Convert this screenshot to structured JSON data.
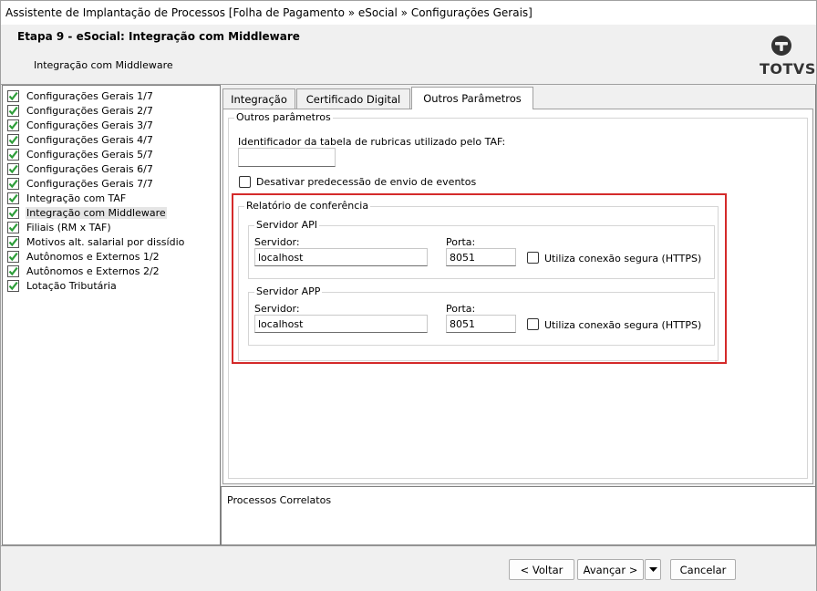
{
  "window": {
    "title": "Assistente de Implantação de Processos [Folha de Pagamento » eSocial » Configurações Gerais]"
  },
  "header": {
    "step_title": "Etapa 9 - eSocial: Integração com Middleware",
    "subtitle": "Integração com Middleware",
    "logo_text": "TOTVS"
  },
  "sidebar": {
    "items": [
      {
        "label": "Configurações Gerais 1/7"
      },
      {
        "label": "Configurações Gerais 2/7"
      },
      {
        "label": "Configurações Gerais 3/7"
      },
      {
        "label": "Configurações Gerais 4/7"
      },
      {
        "label": "Configurações Gerais 5/7"
      },
      {
        "label": "Configurações Gerais 6/7"
      },
      {
        "label": "Configurações Gerais 7/7"
      },
      {
        "label": "Integração com TAF"
      },
      {
        "label": "Integração com Middleware",
        "selected": true
      },
      {
        "label": "Filiais (RM x TAF)"
      },
      {
        "label": "Motivos alt. salarial por dissídio"
      },
      {
        "label": "Autônomos e Externos 1/2"
      },
      {
        "label": "Autônomos e Externos 2/2"
      },
      {
        "label": "Lotação Tributária"
      }
    ]
  },
  "tabs": [
    {
      "label": "Integração"
    },
    {
      "label": "Certificado Digital"
    },
    {
      "label": "Outros Parâmetros",
      "active": true
    }
  ],
  "outros": {
    "group_title": "Outros parâmetros",
    "taf_table_label": "Identificador da tabela de rubricas utilizado pelo TAF:",
    "taf_table_value": "",
    "disable_predecessao_label": "Desativar predecessão de envio de eventos",
    "disable_predecessao_checked": false,
    "relatorio": {
      "title": "Relatório de conferência",
      "api": {
        "title": "Servidor API",
        "server_label": "Servidor:",
        "server_value": "localhost",
        "port_label": "Porta:",
        "port_value": "8051",
        "https_label": "Utiliza conexão segura (HTTPS)",
        "https_checked": false
      },
      "app": {
        "title": "Servidor APP",
        "server_label": "Servidor:",
        "server_value": "localhost",
        "port_label": "Porta:",
        "port_value": "8051",
        "https_label": "Utiliza conexão segura (HTTPS)",
        "https_checked": false
      }
    }
  },
  "processos": {
    "label": "Processos Correlatos"
  },
  "footer": {
    "back_label": "< Voltar",
    "next_label": "Avançar >",
    "cancel_label": "Cancelar"
  },
  "colors": {
    "highlight": "#d42a2a",
    "check_green": "#2e9e3a"
  }
}
